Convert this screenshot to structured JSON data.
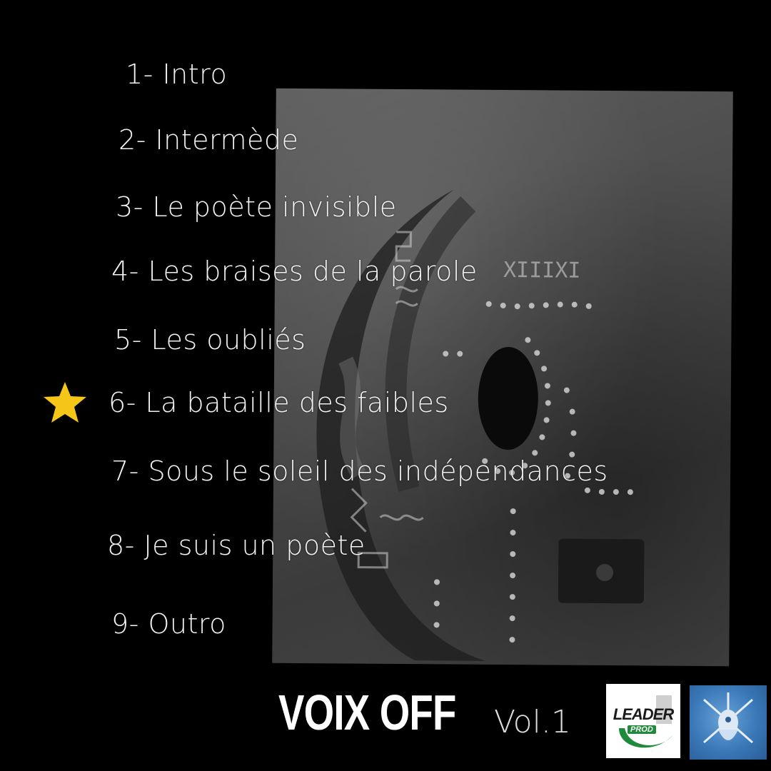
{
  "tracks": [
    "1- Intro",
    "2- Intermède",
    "3- Le poète invisible",
    "4- Les braises de la parole",
    "5- Les oubliés",
    "6- La bataille des faibles",
    "7- Sous le soleil des indépendances",
    "8- Je suis un poète",
    "9- Outro"
  ],
  "highlighted_track_index": 5,
  "album": {
    "title": "VOIX OFF",
    "volume": "Vol.1"
  },
  "logos": {
    "left_text": "LEADER",
    "left_sub": "PROD"
  },
  "icons": {
    "highlight": "star-icon"
  },
  "colors": {
    "background": "#000000",
    "star": "#f5c518",
    "text": "#f2f2f2",
    "leader_green": "#1f8a3a",
    "blue_logo": "#3a78b8"
  }
}
